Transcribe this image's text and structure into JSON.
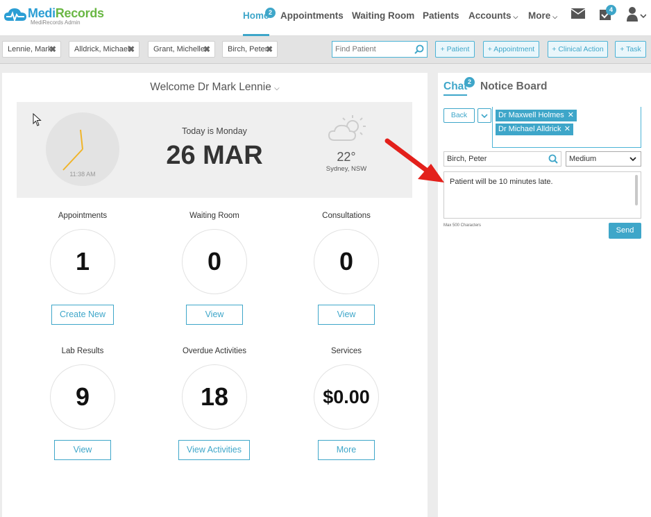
{
  "app": {
    "brand": "MediRecords",
    "brand_prefix": "Medi",
    "brand_suffix": "Records",
    "subtitle": "MediRecords Admin"
  },
  "nav": {
    "home": "Home",
    "home_badge": "2",
    "appointments": "Appointments",
    "waiting_room": "Waiting Room",
    "patients": "Patients",
    "accounts": "Accounts",
    "more": "More",
    "tasks_badge": "4"
  },
  "patient_tabs": [
    "Lennie, Mark",
    "Alldrick, Michael",
    "Grant, Michelle",
    "Birch, Peter"
  ],
  "find_patient": {
    "placeholder": "Find Patient"
  },
  "quick_actions": {
    "patient": "+ Patient",
    "appointment": "+ Appointment",
    "clinical_action": "+ Clinical Action",
    "task": "+ Task"
  },
  "dashboard": {
    "welcome": "Welcome Dr Mark Lennie",
    "today_label": "Today is Monday",
    "date": "26 MAR",
    "time": "11:38 AM",
    "temperature": "22°",
    "location": "Sydney, NSW",
    "weather_icon": "partly-cloudy-icon"
  },
  "stats": [
    {
      "label": "Appointments",
      "value": "1",
      "button": "Create New"
    },
    {
      "label": "Waiting Room",
      "value": "0",
      "button": "View"
    },
    {
      "label": "Consultations",
      "value": "0",
      "button": "View"
    },
    {
      "label": "Lab Results",
      "value": "9",
      "button": "View"
    },
    {
      "label": "Overdue Activities",
      "value": "18",
      "button": "View Activities"
    },
    {
      "label": "Services",
      "value": "$0.00",
      "button": "More"
    }
  ],
  "chat": {
    "tab_chat": "Chat",
    "chat_badge": "2",
    "tab_notice": "Notice Board",
    "back": "Back",
    "recipients": [
      "Dr Maxwell Holmes",
      "Dr Michael Alldrick"
    ],
    "patient": "Birch, Peter",
    "priority": "Medium",
    "message": "Patient will be 10 minutes late.",
    "max_chars": "Max 500 Characters",
    "send": "Send"
  },
  "colors": {
    "accent": "#3ea6c9",
    "brand_green": "#6ab744",
    "annotation_arrow": "#e3201b"
  }
}
